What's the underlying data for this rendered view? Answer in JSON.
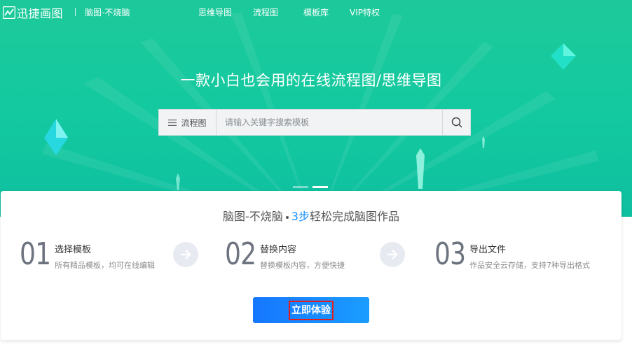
{
  "header": {
    "logo_text": "迅捷画图",
    "slogan": "脑图-不烧脑",
    "nav": [
      {
        "label": "思维导图"
      },
      {
        "label": "流程图"
      },
      {
        "label": "模板库"
      },
      {
        "label": "VIP特权"
      }
    ]
  },
  "hero": {
    "headline": "一款小白也会用的在线流程图/思维导图",
    "colors": {
      "top": "#1dc99a",
      "bottom": "#0fbfa0"
    }
  },
  "search": {
    "category_label": "流程图",
    "placeholder": "请输入关键字搜索模板",
    "value": "",
    "icons": {
      "category": "menu-icon",
      "submit": "search-icon"
    }
  },
  "carousel": {
    "count": 2,
    "active_index": 1
  },
  "steps_card": {
    "title_prefix": "脑图-不烧脑",
    "title_count": "3步",
    "title_suffix": "轻松完成脑图作品",
    "steps": [
      {
        "number": "01",
        "title": "选择模板",
        "desc": "所有精品模板，均可在线编辑"
      },
      {
        "number": "02",
        "title": "替换内容",
        "desc": "替换模板内容，方便快捷"
      },
      {
        "number": "03",
        "title": "导出文件",
        "desc": "作品安全云存储，支持7种导出格式"
      }
    ],
    "cta_label": "立即体验",
    "accent_color": "#1890ff",
    "cta_highlight_color": "#e02020"
  }
}
